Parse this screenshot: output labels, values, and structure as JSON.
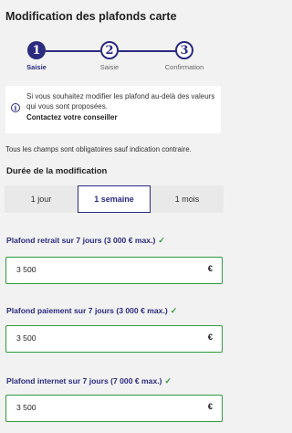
{
  "header": {
    "title": "Modification des plafonds carte"
  },
  "stepper": {
    "steps": [
      {
        "number": "1",
        "label": "Saisie",
        "active": true
      },
      {
        "number": "2",
        "label": "Saisie",
        "active": false
      },
      {
        "number": "3",
        "label": "Confirmation",
        "active": false
      }
    ],
    "accent_color": "#2b2b80"
  },
  "info": {
    "icon": "info-icon",
    "text": "Si vous souhaitez modifier les plafond au-delà des valeurs qui vous sont proposées.",
    "link": "Contactez  votre conseiller"
  },
  "mandatory_note": "Tous les champs sont obligatoires sauf indication contraire.",
  "duration": {
    "label": "Durée de la modification",
    "options": [
      "1 jour",
      "1 semaine",
      "1 mois"
    ],
    "selected": "1 semaine"
  },
  "fields": [
    {
      "label": "Plafond retrait sur 7 jours (3 000 € max.)",
      "value": "3 500",
      "unit": "€",
      "valid": true
    },
    {
      "label": "Plafond paiement sur 7 jours (3 000 € max.)",
      "value": "3 500",
      "unit": "€",
      "valid": true
    },
    {
      "label": "Plafond internet sur 7 jours (7 000 € max.)",
      "value": "3 500",
      "unit": "€",
      "valid": true
    }
  ],
  "colors": {
    "valid": "#2e9b3d",
    "accent": "#2b2b80"
  }
}
